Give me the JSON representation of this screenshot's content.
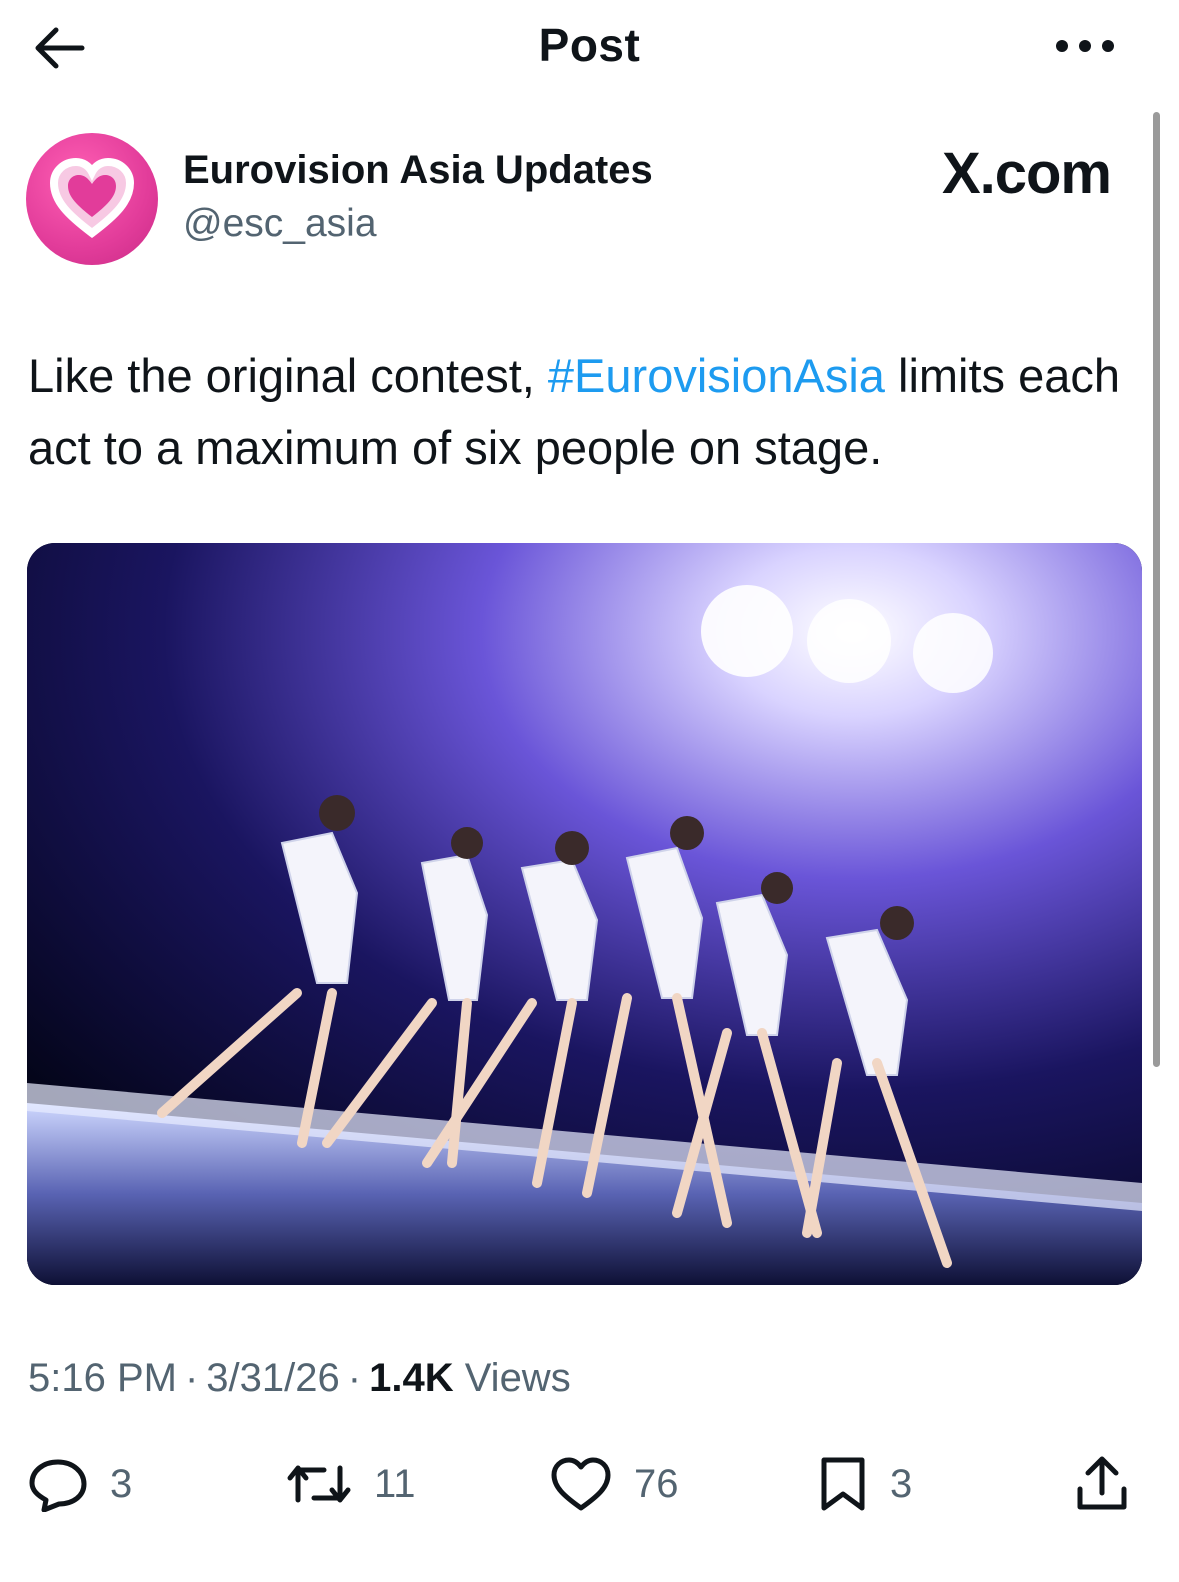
{
  "header": {
    "title": "Post",
    "back_icon": "arrow-left-icon",
    "more_icon": "more-horizontal-icon"
  },
  "author": {
    "name": "Eurovision Asia Updates",
    "handle": "@esc_asia",
    "avatar_icon": "heart-icon",
    "avatar_color": "#e63d9e"
  },
  "brand": "X.com",
  "post": {
    "text_before": "Like the original contest, ",
    "hashtag": "#EurovisionAsia",
    "text_after": " limits each act to a maximum of six people on stage.",
    "hashtag_color": "#1d9bf0"
  },
  "media": {
    "description": "Six performers in white sailor uniforms saluting on a lit stage"
  },
  "meta": {
    "time": "5:16 PM",
    "date": "3/31/26",
    "views_count": "1.4K",
    "views_label": "Views"
  },
  "actions": {
    "reply": {
      "icon": "reply-icon",
      "count": "3"
    },
    "repost": {
      "icon": "repost-icon",
      "count": "11"
    },
    "like": {
      "icon": "heart-outline-icon",
      "count": "76"
    },
    "bookmark": {
      "icon": "bookmark-icon",
      "count": "3"
    },
    "share": {
      "icon": "share-icon"
    }
  }
}
